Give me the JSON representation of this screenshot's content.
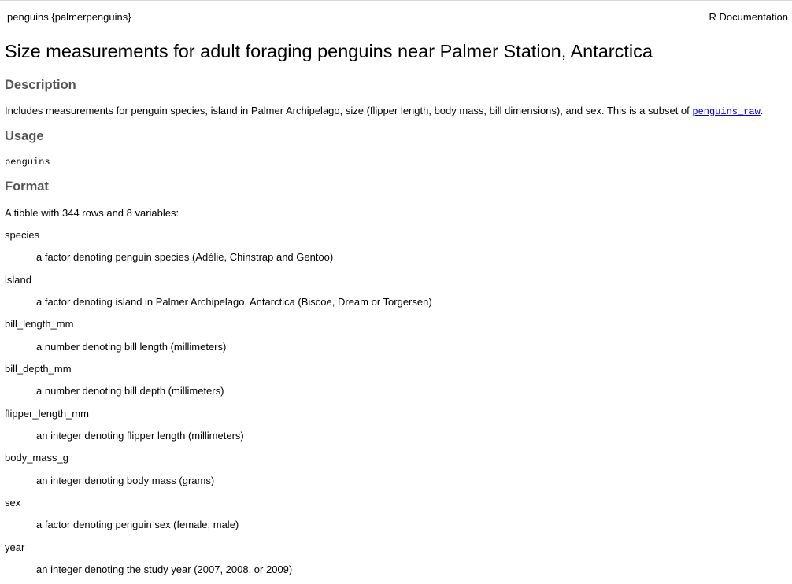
{
  "header": {
    "topic": "penguins {palmerpenguins}",
    "doc_label": "R Documentation"
  },
  "title": "Size measurements for adult foraging penguins near Palmer Station, Antarctica",
  "description": {
    "heading": "Description",
    "text_before": "Includes measurements for penguin species, island in Palmer Archipelago, size (flipper length, body mass, bill dimensions), and sex. This is a subset of ",
    "link_text": "penguins_raw",
    "text_after": "."
  },
  "usage": {
    "heading": "Usage",
    "code": "penguins"
  },
  "format": {
    "heading": "Format",
    "intro": "A tibble with 344 rows and 8 variables:",
    "variables": [
      {
        "name": "species",
        "desc": "a factor denoting penguin species (Adélie, Chinstrap and Gentoo)"
      },
      {
        "name": "island",
        "desc": "a factor denoting island in Palmer Archipelago, Antarctica (Biscoe, Dream or Torgersen)"
      },
      {
        "name": "bill_length_mm",
        "desc": "a number denoting bill length (millimeters)"
      },
      {
        "name": "bill_depth_mm",
        "desc": "a number denoting bill depth (millimeters)"
      },
      {
        "name": "flipper_length_mm",
        "desc": "an integer denoting flipper length (millimeters)"
      },
      {
        "name": "body_mass_g",
        "desc": "an integer denoting body mass (grams)"
      },
      {
        "name": "sex",
        "desc": "a factor denoting penguin sex (female, male)"
      },
      {
        "name": "year",
        "desc": "an integer denoting the study year (2007, 2008, or 2009)"
      }
    ]
  }
}
